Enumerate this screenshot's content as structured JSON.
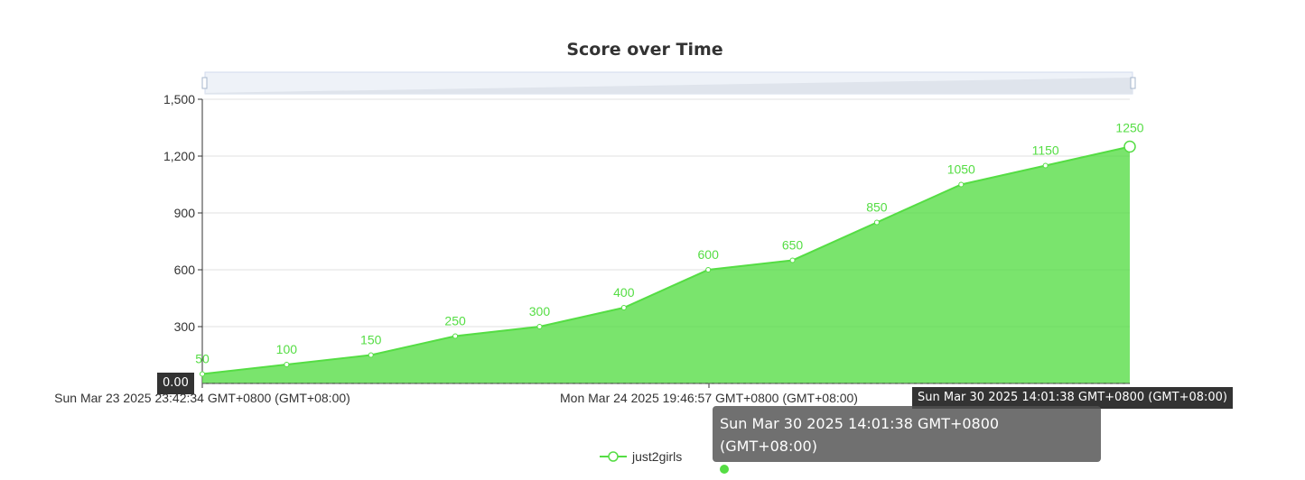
{
  "chart_data": {
    "type": "area",
    "title": "Score over Time",
    "series": [
      {
        "name": "just2girls",
        "color": "#55dd44",
        "values": [
          50,
          100,
          150,
          250,
          300,
          400,
          600,
          650,
          850,
          1050,
          1150,
          1250
        ]
      }
    ],
    "ylim": [
      0,
      1500
    ],
    "yticks": [
      "1,500",
      "1,200",
      "900",
      "600",
      "300"
    ],
    "x_tick_labels": [
      "Sun Mar 23 2025 23:42:34 GMT+0800 (GMT+08:00)",
      "Mon Mar 24 2025 19:46:57 GMT+0800 (GMT+08:00)"
    ],
    "grid": true,
    "legend": "bottom-center",
    "data_zoom_slider": true
  },
  "axis_pointer": {
    "y_label": "0.00",
    "x_label": "Sun Mar 30 2025 14:01:38 GMT+0800 (GMT+08:00)"
  },
  "tooltip": {
    "header": "Sun Mar 30 2025 14:01:38 GMT+0800 (GMT+08:00)",
    "series_name": "just2girls",
    "value": "1,250"
  }
}
